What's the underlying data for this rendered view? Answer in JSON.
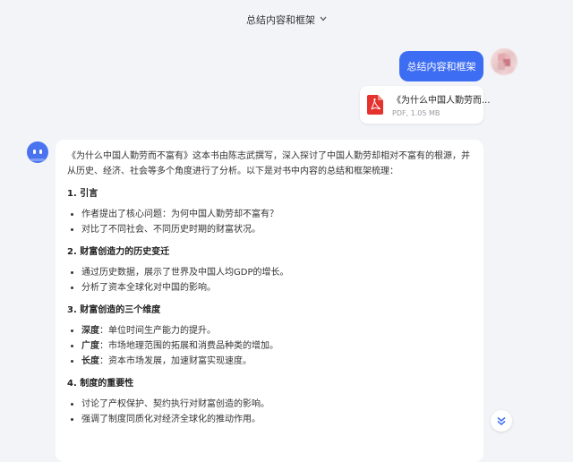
{
  "header": {
    "title": "总结内容和框架"
  },
  "user_message": {
    "text": "总结内容和框架"
  },
  "attachment": {
    "file_name": "《为什么中国人勤劳而...",
    "meta": "PDF, 1.05 MB",
    "type": "pdf"
  },
  "answer": {
    "intro": "《为什么中国人勤劳而不富有》这本书由陈志武撰写，深入探讨了中国人勤劳却相对不富有的根源，并从历史、经济、社会等多个角度进行了分析。以下是对书中内容的总结和框架梳理：",
    "sections": [
      {
        "heading": "1. 引言",
        "items": [
          {
            "text": "作者提出了核心问题：为何中国人勤劳却不富有？"
          },
          {
            "text": "对比了不同社会、不同历史时期的财富状况。"
          }
        ]
      },
      {
        "heading": "2. 财富创造力的历史变迁",
        "items": [
          {
            "text": "通过历史数据，展示了世界及中国人均GDP的增长。"
          },
          {
            "text": "分析了资本全球化对中国的影响。"
          }
        ]
      },
      {
        "heading": "3. 财富创造的三个维度",
        "items": [
          {
            "term": "深度",
            "text": "：单位时间生产能力的提升。"
          },
          {
            "term": "广度",
            "text": "：市场地理范围的拓展和消费品种类的增加。"
          },
          {
            "term": "长度",
            "text": "：资本市场发展，加速财富实现速度。"
          }
        ]
      },
      {
        "heading": "4. 制度的重要性",
        "items": [
          {
            "text": "讨论了产权保护、契约执行对财富创造的影响。"
          },
          {
            "text": "强调了制度同质化对经济全球化的推动作用。"
          }
        ]
      }
    ]
  },
  "icons": {
    "header_dropdown": "chevron-down-icon",
    "attachment": "pdf-file-icon",
    "assistant_avatar": "robot-icon",
    "user_avatar": "avatar",
    "scroll": "double-chevron-down-icon"
  },
  "colors": {
    "accent": "#3d6df2",
    "background": "#f3f4f8",
    "pdf_red": "#e5322d"
  }
}
